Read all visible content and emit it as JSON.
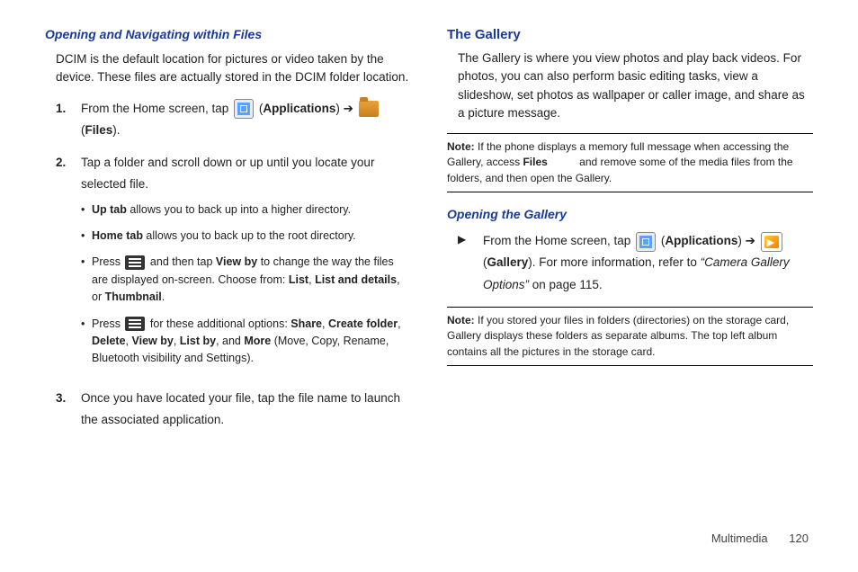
{
  "left": {
    "subhead": "Opening and Navigating within Files",
    "intro": "DCIM is the default location for pictures or video taken by the device. These files are actually stored in the DCIM folder location.",
    "step1_a": "From the Home screen, tap ",
    "step1_b": " (",
    "step1_apps": "Applications",
    "step1_c": ") ➔ ",
    "step1_d": " (",
    "step1_files": "Files",
    "step1_e": ").",
    "step2": "Tap a folder and scroll down or up until you locate your selected file.",
    "b1_a": "Up tab",
    "b1_b": " allows you to back up into a higher directory.",
    "b2_a": "Home tab",
    "b2_b": " allows you to back up to the root directory.",
    "b3_a": "Press ",
    "b3_b": " and then tap ",
    "b3_viewby": "View by",
    "b3_c": " to change the way the files are displayed on-screen. Choose from: ",
    "b3_list": "List",
    "b3_sep1": ", ",
    "b3_listdetails": "List and details",
    "b3_sep2": ", or ",
    "b3_thumb": "Thumbnail",
    "b3_end": ".",
    "b4_a": "Press ",
    "b4_b": " for these additional options: ",
    "b4_share": "Share",
    "b4_s1": ", ",
    "b4_create": "Create folder",
    "b4_s2": ", ",
    "b4_delete": "Delete",
    "b4_s3": ", ",
    "b4_view": "View by",
    "b4_s4": ", ",
    "b4_listby": "List by",
    "b4_s5": ", and ",
    "b4_more": "More",
    "b4_tail": " (Move, Copy, Rename, Bluetooth visibility and Settings).",
    "step3": "Once you have located your file, tap the file name to launch the associated application."
  },
  "right": {
    "head": "The Gallery",
    "intro": "The Gallery is where you view photos and play back videos. For photos, you can also perform basic editing tasks, view a slideshow, set photos as wallpaper or caller image, and share as a picture message.",
    "note1_label": "Note:",
    "note1_a": " If the phone displays a memory full message when accessing the Gallery, access ",
    "note1_files": "Files",
    "note1_b": " and remove some of the media files from the folders, and then open the Gallery.",
    "subhead2": "Opening the Gallery",
    "g_a": "From the Home screen, tap ",
    "g_b": " (",
    "g_apps": "Applications",
    "g_c": ") ➔ ",
    "g_d": " (",
    "g_gallery": "Gallery",
    "g_e": "). For more information, refer to ",
    "g_ref": "“Camera Gallery Options”",
    "g_f": "  on page 115.",
    "note2_label": "Note:",
    "note2_body": " If you stored your files in folders (directories) on the storage card, Gallery displays these folders as separate albums. The top left album contains all the pictures in the storage card."
  },
  "footer": {
    "section": "Multimedia",
    "page": "120"
  }
}
